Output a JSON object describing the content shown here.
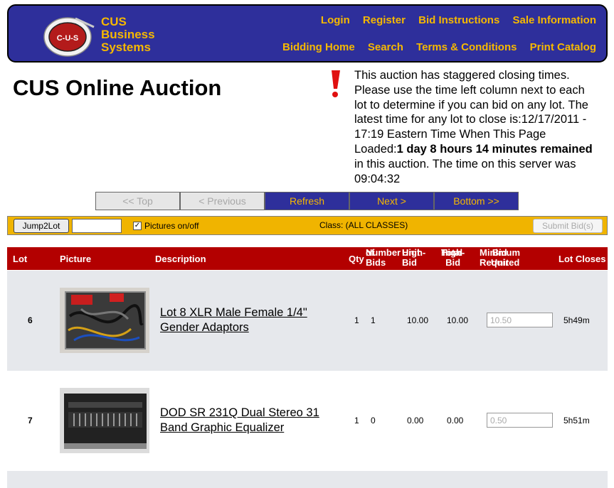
{
  "header": {
    "brand": [
      "CUS",
      "Business",
      "Systems"
    ],
    "logo_text": "C-U-S",
    "nav_top": [
      "Login",
      "Register",
      "Bid Instructions",
      "Sale Information"
    ],
    "nav_bottom": [
      "Bidding Home",
      "Search",
      "Terms & Conditions",
      "Print Catalog"
    ]
  },
  "page_title": "CUS Online Auction",
  "notice": {
    "text1": "This auction has staggered closing times. Please use the time left column next to each lot to determine if you can bid on any lot. The latest time for any lot to close is:12/17/2011 - 17:19 Eastern Time When This Page Loaded:",
    "bold": "1 day 8 hours 14 minutes remained",
    "text2": " in this auction. The time on this server was 09:04:32"
  },
  "pager": [
    "<< Top",
    "< Previous",
    "Refresh",
    "Next >",
    "Bottom >>"
  ],
  "toolbar": {
    "jump_label": "Jump2Lot",
    "pictures_label": "Pictures on/off",
    "class_label": "Class: (ALL CLASSES)",
    "submit_label": "Submit Bid(s)"
  },
  "columns": {
    "lot": "Lot",
    "picture": "Picture",
    "description": "Description",
    "qty": "Qty",
    "bids": [
      "Number",
      "of Bids"
    ],
    "unit_high": [
      "Unit",
      "High-Bid"
    ],
    "total_high": [
      "Total",
      "High-Bid"
    ],
    "min_unit": [
      "Minimum Unit",
      "Bid Required"
    ],
    "closes": "Lot Closes"
  },
  "rows": [
    {
      "lot": "6",
      "description": "Lot 8 XLR Male Female 1/4\" Gender Adaptors",
      "qty": "1",
      "bids": "1",
      "unit_high": "10.00",
      "total_high": "10.00",
      "min_bid": "10.50",
      "closes": "5h49m"
    },
    {
      "lot": "7",
      "description": "DOD SR 231Q Dual Stereo 31 Band Graphic Equalizer",
      "qty": "1",
      "bids": "0",
      "unit_high": "0.00",
      "total_high": "0.00",
      "min_bid": "0.50",
      "closes": "5h51m"
    }
  ]
}
